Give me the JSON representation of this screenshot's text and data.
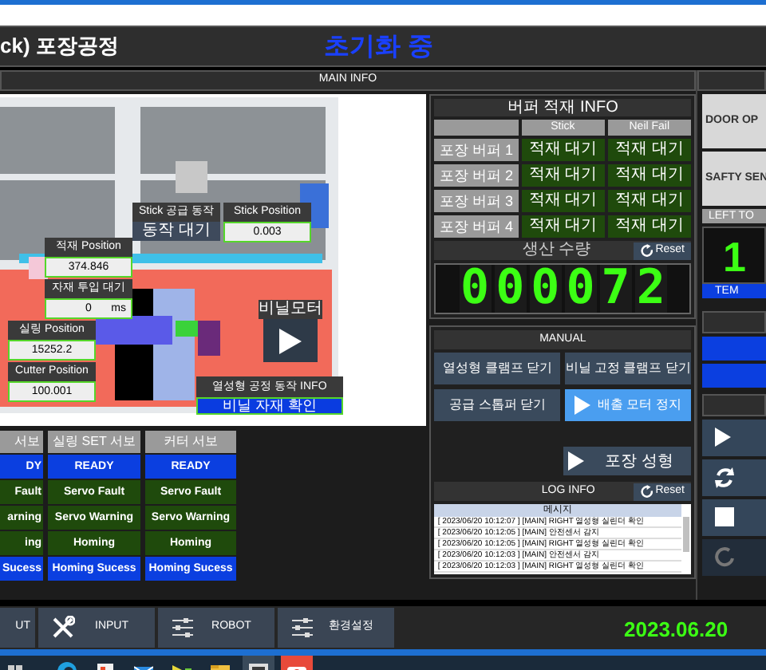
{
  "window": {
    "title": "ck) 포장공정",
    "status": "초기화 중"
  },
  "main_info": {
    "title": "MAIN INFO",
    "overlays": [
      {
        "label": "Stick 공급 동작",
        "value": "동작 대기",
        "kind": "status"
      },
      {
        "label": "Stick Position",
        "value": "0.003",
        "kind": "value"
      },
      {
        "label": "적재 Position",
        "value": "374.846",
        "kind": "value"
      },
      {
        "label": "자재 투입 대기",
        "value": "0",
        "unit": "ms",
        "kind": "value"
      },
      {
        "label": "실링 Position",
        "value": "15252.2",
        "kind": "value"
      },
      {
        "label": "Cutter Position",
        "value": "100.001",
        "kind": "value"
      }
    ],
    "motor": {
      "label": "비닐모터"
    },
    "process": {
      "label": "열성형 공정 동작 INFO",
      "value": "비닐 자재 확인"
    }
  },
  "servos": [
    {
      "header": "서보",
      "states": [
        {
          "label": "DY",
          "on": true
        },
        {
          "label": "Fault",
          "on": false
        },
        {
          "label": "arning",
          "on": false
        },
        {
          "label": "ing",
          "on": false
        },
        {
          "label": "Sucess",
          "on": true
        }
      ]
    },
    {
      "header": "실링 SET 서보",
      "states": [
        {
          "label": "READY",
          "on": true
        },
        {
          "label": "Servo Fault",
          "on": false
        },
        {
          "label": "Servo Warning",
          "on": false
        },
        {
          "label": "Homing",
          "on": false
        },
        {
          "label": "Homing Sucess",
          "on": true
        }
      ]
    },
    {
      "header": "커터 서보",
      "states": [
        {
          "label": "READY",
          "on": true
        },
        {
          "label": "Servo Fault",
          "on": false
        },
        {
          "label": "Servo Warning",
          "on": false
        },
        {
          "label": "Homing",
          "on": false
        },
        {
          "label": "Homing Sucess",
          "on": true
        }
      ]
    }
  ],
  "buffer": {
    "title": "버퍼 적재 INFO",
    "columns": [
      "Stick",
      "Neil Fail"
    ],
    "rows": [
      {
        "label": "포장 버퍼 1",
        "cells": [
          "적재 대기",
          "적재 대기"
        ]
      },
      {
        "label": "포장 버퍼 2",
        "cells": [
          "적재 대기",
          "적재 대기"
        ]
      },
      {
        "label": "포장 버퍼 3",
        "cells": [
          "적재 대기",
          "적재 대기"
        ]
      },
      {
        "label": "포장 버퍼 4",
        "cells": [
          "적재 대기",
          "적재 대기"
        ]
      }
    ]
  },
  "production": {
    "label": "생산 수량",
    "reset": "Reset",
    "count": "000072"
  },
  "manual": {
    "title": "MANUAL",
    "buttons": [
      {
        "label": "열성형 클램프 닫기",
        "active": false
      },
      {
        "label": "비닐 고정 클램프 닫기",
        "active": false
      },
      {
        "label": "공급 스톱퍼 닫기",
        "active": false
      },
      {
        "label": "배출 모터 정지",
        "active": true
      }
    ],
    "form_button": "포장 성형"
  },
  "log": {
    "title": "LOG INFO",
    "reset": "Reset",
    "column": "메시지",
    "rows": [
      "[ 2023/06/20 10:12:07 ] [MAIN] RIGHT 열성형 실린더 확인",
      "[ 2023/06/20 10:12:05 ] [MAIN] 안전센서 감지",
      "[ 2023/06/20 10:12:05 ] [MAIN] RIGHT 열성형 실린더 확인",
      "[ 2023/06/20 10:12:03 ] [MAIN] 안전센서 감지",
      "[ 2023/06/20 10:12:03 ] [MAIN] RIGHT 열성형 실린더 확인"
    ]
  },
  "side": {
    "buttons": [
      "DOOR OP",
      "SAFTY SEN"
    ],
    "label": "LEFT TO",
    "value": "1",
    "unit": "TEM"
  },
  "nav": [
    {
      "label": "UT",
      "kind": "plain"
    },
    {
      "label": "INPUT",
      "kind": "tools"
    },
    {
      "label": "ROBOT",
      "kind": "settings"
    },
    {
      "label": "환경설정",
      "kind": "settings"
    }
  ],
  "date": "2023.06.20"
}
